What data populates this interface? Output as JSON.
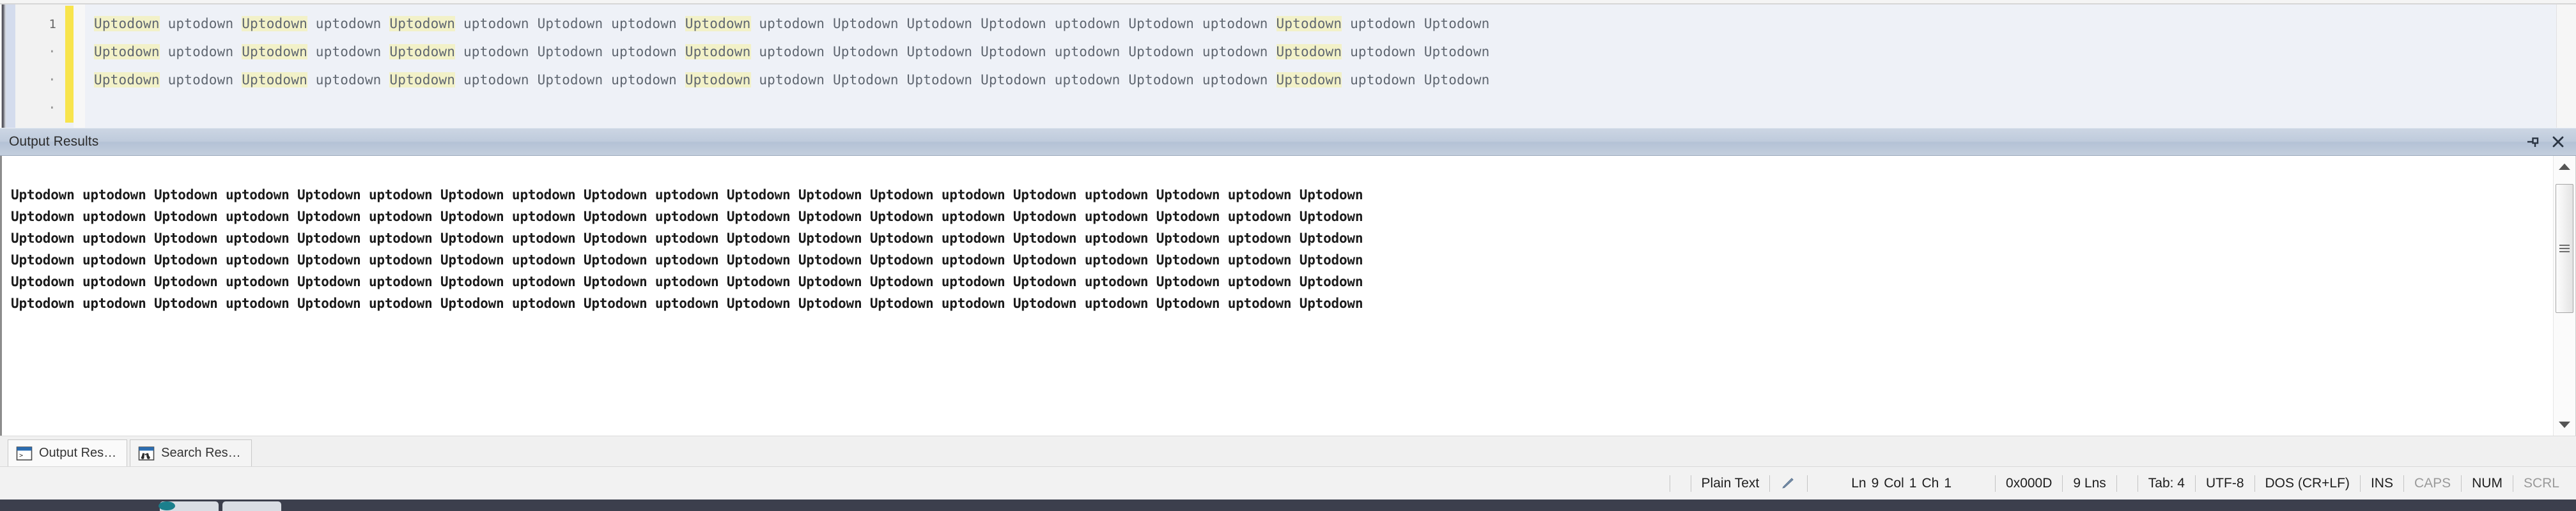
{
  "editor": {
    "gutter": {
      "line_number": "1",
      "wrap_markers": [
        "·",
        "·",
        "·"
      ]
    },
    "lines": [
      [
        {
          "t": "Uptodown",
          "hl": true
        },
        {
          "t": "uptodown",
          "hl": false
        },
        {
          "t": "Uptodown",
          "hl": true
        },
        {
          "t": "uptodown",
          "hl": false
        },
        {
          "t": "Uptodown",
          "hl": true
        },
        {
          "t": "uptodown",
          "hl": false
        },
        {
          "t": "Uptodown",
          "hl": false
        },
        {
          "t": "uptodown",
          "hl": false
        },
        {
          "t": "Uptodown",
          "hl": true
        },
        {
          "t": "uptodown",
          "hl": false
        },
        {
          "t": "Uptodown",
          "hl": false
        },
        {
          "t": "Uptodown",
          "hl": false
        },
        {
          "t": "Uptodown",
          "hl": false
        },
        {
          "t": "uptodown",
          "hl": false
        },
        {
          "t": "Uptodown",
          "hl": false
        },
        {
          "t": "uptodown",
          "hl": false
        },
        {
          "t": "Uptodown",
          "hl": true
        },
        {
          "t": "uptodown",
          "hl": false
        },
        {
          "t": "Uptodown",
          "hl": false
        }
      ],
      [
        {
          "t": "Uptodown",
          "hl": true
        },
        {
          "t": "uptodown",
          "hl": false
        },
        {
          "t": "Uptodown",
          "hl": true
        },
        {
          "t": "uptodown",
          "hl": false
        },
        {
          "t": "Uptodown",
          "hl": true
        },
        {
          "t": "uptodown",
          "hl": false
        },
        {
          "t": "Uptodown",
          "hl": false
        },
        {
          "t": "uptodown",
          "hl": false
        },
        {
          "t": "Uptodown",
          "hl": true
        },
        {
          "t": "uptodown",
          "hl": false
        },
        {
          "t": "Uptodown",
          "hl": false
        },
        {
          "t": "Uptodown",
          "hl": false
        },
        {
          "t": "Uptodown",
          "hl": false
        },
        {
          "t": "uptodown",
          "hl": false
        },
        {
          "t": "Uptodown",
          "hl": false
        },
        {
          "t": "uptodown",
          "hl": false
        },
        {
          "t": "Uptodown",
          "hl": true
        },
        {
          "t": "uptodown",
          "hl": false
        },
        {
          "t": "Uptodown",
          "hl": false
        }
      ],
      [
        {
          "t": "Uptodown",
          "hl": true
        },
        {
          "t": "uptodown",
          "hl": false
        },
        {
          "t": "Uptodown",
          "hl": true
        },
        {
          "t": "uptodown",
          "hl": false
        },
        {
          "t": "Uptodown",
          "hl": true
        },
        {
          "t": "uptodown",
          "hl": false
        },
        {
          "t": "Uptodown",
          "hl": false
        },
        {
          "t": "uptodown",
          "hl": false
        },
        {
          "t": "Uptodown",
          "hl": true
        },
        {
          "t": "uptodown",
          "hl": false
        },
        {
          "t": "Uptodown",
          "hl": false
        },
        {
          "t": "Uptodown",
          "hl": false
        },
        {
          "t": "Uptodown",
          "hl": false
        },
        {
          "t": "uptodown",
          "hl": false
        },
        {
          "t": "Uptodown",
          "hl": false
        },
        {
          "t": "uptodown",
          "hl": false
        },
        {
          "t": "Uptodown",
          "hl": true
        },
        {
          "t": "uptodown",
          "hl": false
        },
        {
          "t": "Uptodown",
          "hl": false
        }
      ]
    ]
  },
  "dock": {
    "title": "Output Results",
    "pin_icon": "pin-icon",
    "close_icon": "close-icon",
    "output_lines": [
      "Uptodown uptodown Uptodown uptodown Uptodown uptodown Uptodown uptodown Uptodown uptodown Uptodown Uptodown Uptodown uptodown Uptodown uptodown Uptodown uptodown Uptodown",
      "Uptodown uptodown Uptodown uptodown Uptodown uptodown Uptodown uptodown Uptodown uptodown Uptodown Uptodown Uptodown uptodown Uptodown uptodown Uptodown uptodown Uptodown",
      "Uptodown uptodown Uptodown uptodown Uptodown uptodown Uptodown uptodown Uptodown uptodown Uptodown Uptodown Uptodown uptodown Uptodown uptodown Uptodown uptodown Uptodown",
      "Uptodown uptodown Uptodown uptodown Uptodown uptodown Uptodown uptodown Uptodown uptodown Uptodown Uptodown Uptodown uptodown Uptodown uptodown Uptodown uptodown Uptodown",
      "Uptodown uptodown Uptodown uptodown Uptodown uptodown Uptodown uptodown Uptodown uptodown Uptodown Uptodown Uptodown uptodown Uptodown uptodown Uptodown uptodown Uptodown",
      "Uptodown uptodown Uptodown uptodown Uptodown uptodown Uptodown uptodown Uptodown uptodown Uptodown Uptodown Uptodown uptodown Uptodown uptodown Uptodown uptodown Uptodown"
    ],
    "tabs": [
      {
        "label": "Output Res…",
        "icon": "console-window-icon",
        "active": true
      },
      {
        "label": "Search Res…",
        "icon": "binoculars-icon",
        "active": false
      }
    ]
  },
  "statusbar": {
    "language": "Plain Text",
    "edit_icon": "pencil-icon",
    "ln_label": "Ln",
    "ln_value": "9",
    "col_label": "Col",
    "col_value": "1",
    "ch_label": "Ch",
    "ch_value": "1",
    "hex_value": "0x000D",
    "line_count": "9 Lns",
    "tab_size": "Tab: 4",
    "encoding": "UTF-8",
    "eol": "DOS (CR+LF)",
    "insert_mode": "INS",
    "caps_lock": "CAPS",
    "num_lock": "NUM",
    "scroll_lock": "SCRL"
  },
  "colors": {
    "editor_bg": "#eef1f7",
    "editor_text": "#5f6670",
    "search_highlight": "#f2f1c8",
    "change_marker": "#f8e44c",
    "dock_title_bg": "#bfcbdc",
    "output_bg": "#ffffff",
    "status_bg": "#f2f2f2",
    "taskbar_bg": "#3c3f4d"
  }
}
